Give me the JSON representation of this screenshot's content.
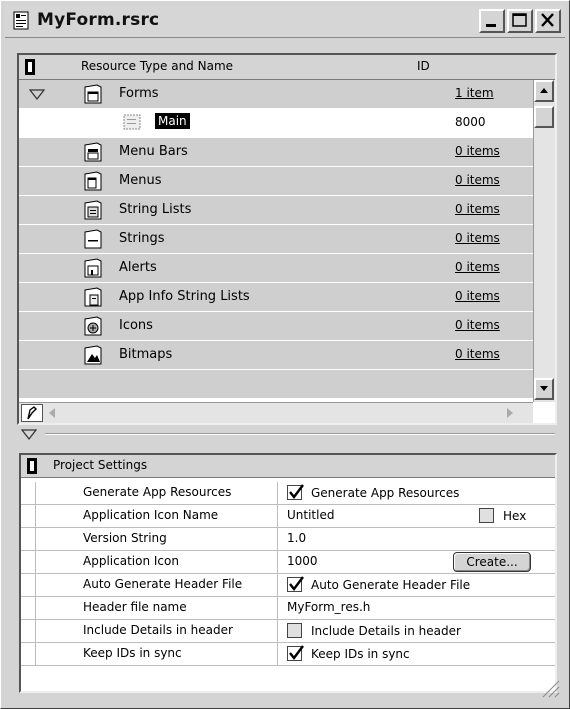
{
  "window": {
    "title": "MyForm.rsrc",
    "minimize_icon": "minimize-icon",
    "maximize_icon": "maximize-icon",
    "close_icon": "close-icon"
  },
  "resources": {
    "col_name": "Resource Type and Name",
    "col_id": "ID",
    "rows": [
      {
        "name": "Forms",
        "id": "1 item",
        "icon": "folder-forms-icon",
        "expanded": true
      },
      {
        "name": "Main",
        "id": "8000",
        "icon": "form-icon",
        "selected": true,
        "child": true
      },
      {
        "name": "Menu Bars",
        "id": "0 items",
        "icon": "folder-menubars-icon"
      },
      {
        "name": "Menus",
        "id": "0 items",
        "icon": "folder-menus-icon"
      },
      {
        "name": "String Lists",
        "id": "0 items",
        "icon": "folder-stringlists-icon"
      },
      {
        "name": "Strings",
        "id": "0 items",
        "icon": "folder-strings-icon"
      },
      {
        "name": "Alerts",
        "id": "0 items",
        "icon": "folder-alerts-icon"
      },
      {
        "name": "App Info String Lists",
        "id": "0 items",
        "icon": "folder-appinfo-icon"
      },
      {
        "name": "Icons",
        "id": "0 items",
        "icon": "folder-icons-icon"
      },
      {
        "name": "Bitmaps",
        "id": "0 items",
        "icon": "folder-bitmaps-icon"
      }
    ]
  },
  "settings": {
    "title": "Project Settings",
    "rows": [
      {
        "label": "Generate App Resources",
        "type": "checkbox",
        "checked": true,
        "text": "Generate App Resources"
      },
      {
        "label": "Application Icon Name",
        "type": "text-hex",
        "value": "Untitled",
        "hex_label": "Hex",
        "hex_checked": false
      },
      {
        "label": "Version String",
        "type": "text",
        "value": "1.0"
      },
      {
        "label": "Application Icon",
        "type": "text-button",
        "value": "1000",
        "button": "Create..."
      },
      {
        "label": "Auto Generate Header File",
        "type": "checkbox",
        "checked": true,
        "text": "Auto Generate Header File"
      },
      {
        "label": "Header file name",
        "type": "text",
        "value": "MyForm_res.h"
      },
      {
        "label": "Include Details in header",
        "type": "checkbox",
        "checked": false,
        "text": "Include Details in header"
      },
      {
        "label": "Keep IDs in sync",
        "type": "checkbox",
        "checked": true,
        "text": "Keep IDs in sync"
      }
    ]
  }
}
